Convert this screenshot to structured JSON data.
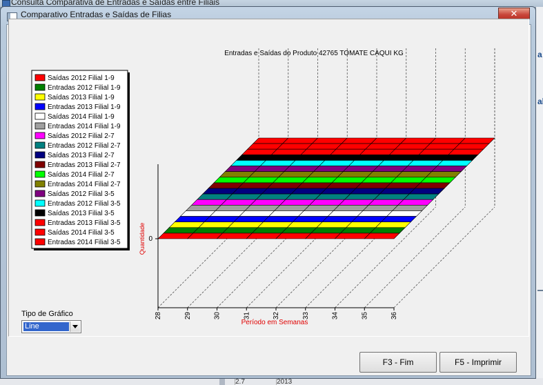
{
  "background_window": {
    "title": "Consulta Comparativa de Entradas e Saídas entre Filiais",
    "right_glyph_a": "a",
    "right_glyph_b": "al",
    "bottom_cell_1": "2.7",
    "bottom_cell_2": "2013"
  },
  "window": {
    "title": "Comparativo Entradas e Saídas de Filias",
    "close_glyph": "✕"
  },
  "chart_type": {
    "label": "Tipo de Gráfico",
    "selected": "Line"
  },
  "buttons": {
    "f3": "F3 - Fim",
    "f5": "F5 - Imprimir"
  },
  "chart_data": {
    "type": "line",
    "title": "Entradas e Saídas do Produto 42765 TOMATE CAQUI KG",
    "xlabel": "Período em Semanas",
    "ylabel": "Quantidade",
    "x": [
      28,
      29,
      30,
      31,
      32,
      33,
      34,
      35,
      36
    ],
    "x_tick_labels": [
      "28",
      "29",
      "30",
      "31",
      "32",
      "33",
      "34",
      "35",
      "36"
    ],
    "y_tick_labels": [
      "0"
    ],
    "three_d": true,
    "legend_position": "left",
    "series": [
      {
        "name": "Saídas   2012 Filial 1-9",
        "color": "#ff0000",
        "values": [
          0,
          0,
          0,
          0,
          0,
          0,
          0,
          0,
          0
        ]
      },
      {
        "name": "Entradas 2012 Filial 1-9",
        "color": "#008000",
        "values": [
          0,
          0,
          0,
          0,
          0,
          0,
          0,
          0,
          0
        ]
      },
      {
        "name": "Saídas   2013 Filial 1-9",
        "color": "#ffff00",
        "values": [
          0,
          0,
          0,
          0,
          0,
          0,
          0,
          0,
          0
        ]
      },
      {
        "name": "Entradas 2013 Filial 1-9",
        "color": "#0000ff",
        "values": [
          0,
          0,
          0,
          0,
          0,
          0,
          0,
          0,
          0
        ]
      },
      {
        "name": "Saídas   2014 Filial 1-9",
        "color": "#ffffff",
        "values": [
          0,
          0,
          0,
          0,
          0,
          0,
          0,
          0,
          0
        ]
      },
      {
        "name": "Entradas 2014 Filial 1-9",
        "color": "#a0a0a0",
        "values": [
          0,
          0,
          0,
          0,
          0,
          0,
          0,
          0,
          0
        ]
      },
      {
        "name": "Saídas   2012 Filial 2-7",
        "color": "#ff00ff",
        "values": [
          0,
          0,
          0,
          0,
          0,
          0,
          0,
          0,
          0
        ]
      },
      {
        "name": "Entradas 2012 Filial 2-7",
        "color": "#008080",
        "values": [
          0,
          0,
          0,
          0,
          0,
          0,
          0,
          0,
          0
        ]
      },
      {
        "name": "Saídas   2013 Filial 2-7",
        "color": "#000080",
        "values": [
          0,
          0,
          0,
          0,
          0,
          0,
          0,
          0,
          0
        ]
      },
      {
        "name": "Entradas 2013 Filial 2-7",
        "color": "#800000",
        "values": [
          0,
          0,
          0,
          0,
          0,
          0,
          0,
          0,
          0
        ]
      },
      {
        "name": "Saídas   2014 Filial 2-7",
        "color": "#00ff00",
        "values": [
          0,
          0,
          0,
          0,
          0,
          0,
          0,
          0,
          0
        ]
      },
      {
        "name": "Entradas 2014 Filial 2-7",
        "color": "#808000",
        "values": [
          0,
          0,
          0,
          0,
          0,
          0,
          0,
          0,
          0
        ]
      },
      {
        "name": "Saídas   2012 Filial 3-5",
        "color": "#800080",
        "values": [
          0,
          0,
          0,
          0,
          0,
          0,
          0,
          0,
          0
        ]
      },
      {
        "name": "Entradas 2012 Filial 3-5",
        "color": "#00ffff",
        "values": [
          0,
          0,
          0,
          0,
          0,
          0,
          0,
          0,
          0
        ]
      },
      {
        "name": "Saídas   2013 Filial 3-5",
        "color": "#000000",
        "values": [
          0,
          0,
          0,
          0,
          0,
          0,
          0,
          0,
          0
        ]
      },
      {
        "name": "Entradas 2013 Filial 3-5",
        "color": "#ff0000",
        "values": [
          0,
          0,
          0,
          0,
          0,
          0,
          0,
          0,
          0
        ]
      },
      {
        "name": "Saídas   2014 Filial 3-5",
        "color": "#ff0000",
        "values": [
          0,
          0,
          0,
          0,
          0,
          0,
          0,
          0,
          0
        ]
      },
      {
        "name": "Entradas 2014 Filial 3-5",
        "color": "#ff0000",
        "values": [
          0,
          0,
          0,
          0,
          0,
          0,
          0,
          0,
          0
        ]
      }
    ]
  }
}
